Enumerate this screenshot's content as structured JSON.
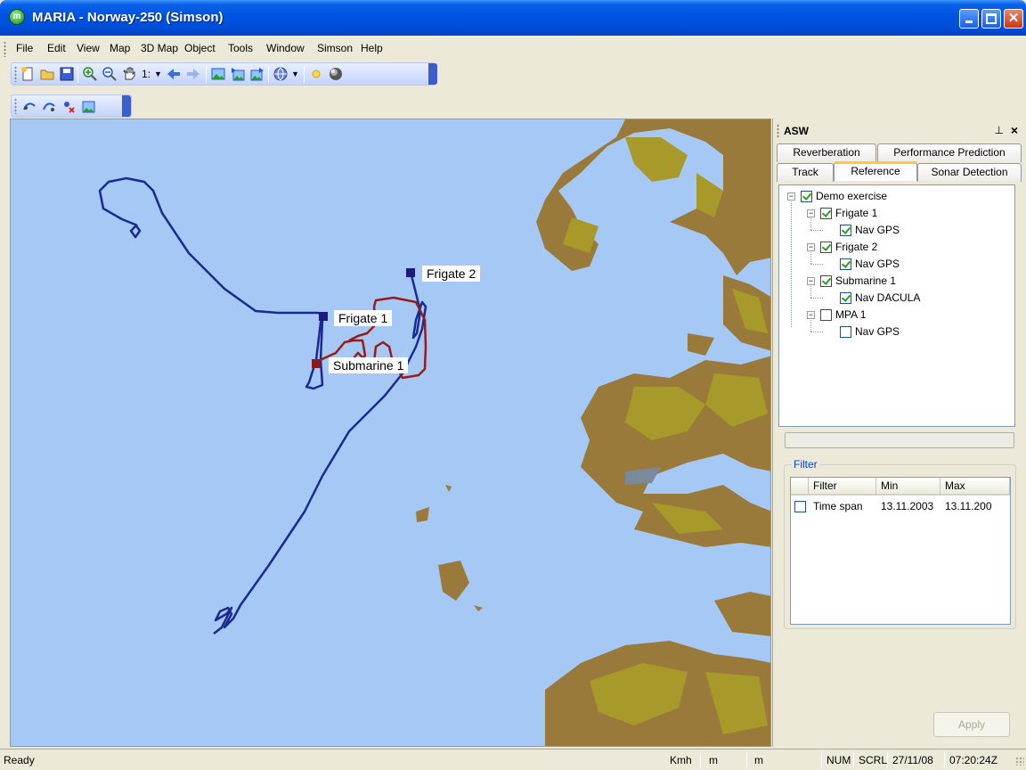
{
  "window": {
    "title": "MARIA - Norway-250 (Simson)",
    "app_icon_glyph": "m"
  },
  "menu": [
    {
      "label": "File"
    },
    {
      "label": "Edit"
    },
    {
      "label": "View"
    },
    {
      "label": "Map"
    },
    {
      "label": "3D Map"
    },
    {
      "label": "Object"
    },
    {
      "label": "Tools"
    },
    {
      "label": "Window"
    },
    {
      "label": "Simson"
    },
    {
      "label": "Help"
    }
  ],
  "toolbar": {
    "scale_label": "1:"
  },
  "map": {
    "units": [
      {
        "name": "Frigate 1",
        "color": "#1a1a80"
      },
      {
        "name": "Frigate 2",
        "color": "#1a1a80"
      },
      {
        "name": "Submarine 1",
        "color": "#8b1a1a"
      }
    ],
    "colors": {
      "sea": "#a6c8f5",
      "land_low": "#9a7a3a",
      "land_high": "#a89a2a",
      "track_blue": "#1a2a90",
      "track_red": "#9a1a1a"
    }
  },
  "panel": {
    "title": "ASW",
    "tabs_row1": [
      {
        "label": "Reverberation"
      },
      {
        "label": "Performance Prediction"
      }
    ],
    "tabs_row2": [
      {
        "label": "Track"
      },
      {
        "label": "Reference"
      },
      {
        "label": "Sonar Detection"
      }
    ],
    "active_tab": "Reference",
    "tree": [
      {
        "label": "Demo exercise",
        "checked": true
      },
      {
        "label": "Frigate 1",
        "checked": true
      },
      {
        "label": "Nav GPS",
        "checked": true
      },
      {
        "label": "Frigate 2",
        "checked": true
      },
      {
        "label": "Nav GPS",
        "checked": true
      },
      {
        "label": "Submarine 1",
        "checked": true
      },
      {
        "label": "Nav DACULA",
        "checked": true
      },
      {
        "label": "MPA 1",
        "checked": false
      },
      {
        "label": "Nav GPS",
        "checked": false
      }
    ],
    "filter": {
      "legend": "Filter",
      "columns": [
        "Filter",
        "Min",
        "Max"
      ],
      "rows": [
        {
          "checked": false,
          "filter": "Time span",
          "min": "13.11.2003",
          "max": "13.11.200"
        }
      ]
    },
    "apply_label": "Apply"
  },
  "status": {
    "left": "Ready",
    "speed_unit": "Kmh",
    "unit1": "m",
    "unit2": "m",
    "num": "NUM",
    "scrl": "SCRL",
    "date": "27/11/08",
    "time": "07:20:24Z"
  }
}
